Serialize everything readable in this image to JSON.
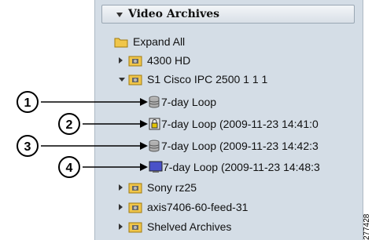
{
  "panel": {
    "header": {
      "title": "Video Archives"
    },
    "tree": {
      "expand_all": "Expand All",
      "items": [
        {
          "label": "4300 HD"
        },
        {
          "label": "S1 Cisco IPC 2500 1 1 1"
        },
        {
          "label": "7-day Loop"
        },
        {
          "label": "7-day Loop (2009-11-23 14:41:0"
        },
        {
          "label": "7-day Loop (2009-11-23 14:42:3"
        },
        {
          "label": "7-day Loop (2009-11-23 14:48:3"
        },
        {
          "label": "Sony rz25"
        },
        {
          "label": "axis7406-60-feed-31"
        },
        {
          "label": "Shelved Archives"
        }
      ]
    }
  },
  "callouts": [
    "1",
    "2",
    "3",
    "4"
  ],
  "figure_id": "277428",
  "icons": {
    "header_toggle": "chevron-down-icon",
    "expand_all": "folder-icon",
    "camera": "camera-folder-icon",
    "loop": "database-icon",
    "locked": "lock-icon",
    "monitor": "monitor-icon"
  },
  "colors": {
    "panel": "#d4dde6",
    "folder": "#f0c64a",
    "monitor": "#4a52c8"
  }
}
